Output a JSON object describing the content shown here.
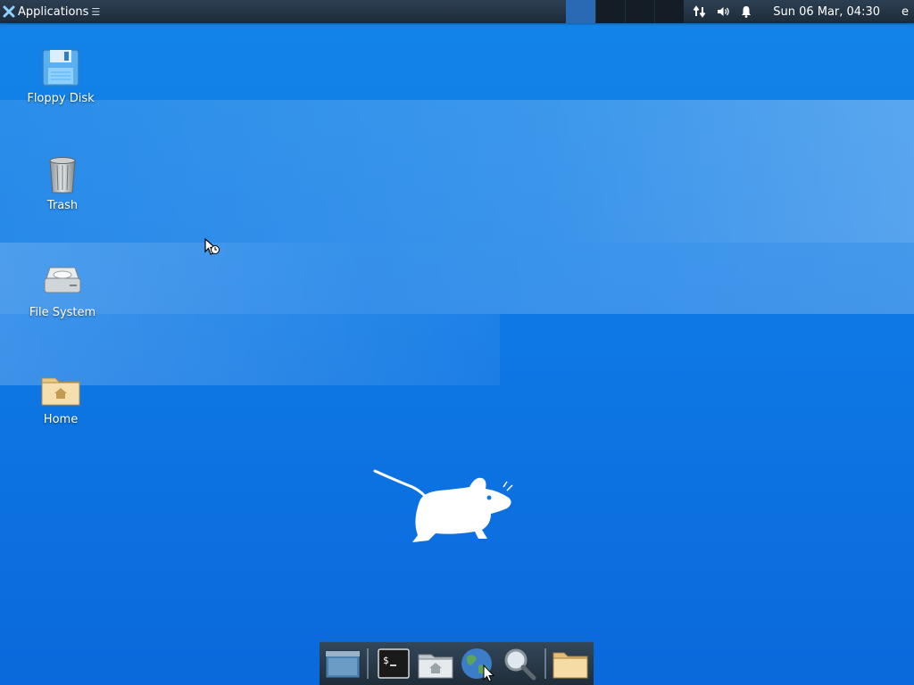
{
  "top_panel": {
    "app_menu_label": "Applications",
    "app_menu_arrow": "☰",
    "workspaces": [
      {
        "name": "workspace-1",
        "active": true
      },
      {
        "name": "workspace-2",
        "active": false
      },
      {
        "name": "workspace-3",
        "active": false
      },
      {
        "name": "workspace-4",
        "active": false
      }
    ],
    "tray_icons": [
      "network-arrows-icon",
      "volume-icon",
      "notification-bell-icon"
    ],
    "clock": "Sun 06 Mar, 04:30",
    "tail_label": "e",
    "background": "#1d2b39"
  },
  "desktop": {
    "background": "#0f7be6",
    "icons": [
      {
        "label": "Floppy Disk",
        "icon": "floppy-disk-icon"
      },
      {
        "label": "Trash",
        "icon": "trash-icon"
      },
      {
        "label": "File System",
        "icon": "hard-drive-icon"
      },
      {
        "label": "Home",
        "icon": "home-folder-icon"
      }
    ]
  },
  "dock": {
    "items": [
      {
        "icon": "show-desktop-icon"
      },
      {
        "icon": "terminal-icon"
      },
      {
        "icon": "home-folder-icon"
      },
      {
        "icon": "web-browser-icon"
      },
      {
        "icon": "search-icon"
      },
      {
        "icon": "folder-icon"
      }
    ]
  }
}
